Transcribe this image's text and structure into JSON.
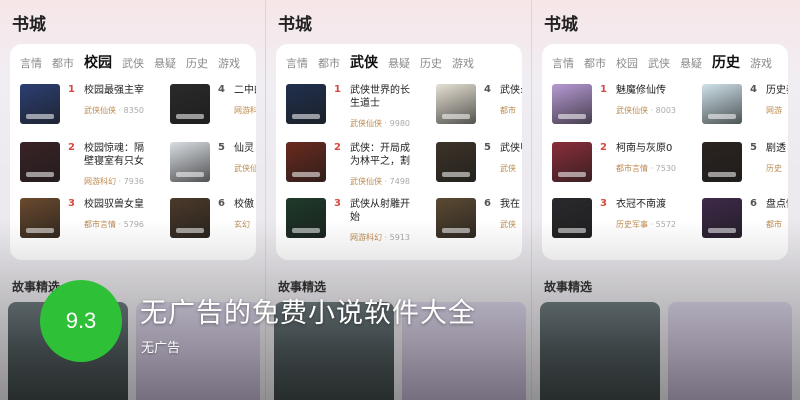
{
  "screens": [
    {
      "title": "书城",
      "tabs": [
        "言情",
        "都市",
        "校园",
        "武侠",
        "悬疑",
        "历史",
        "游戏"
      ],
      "active_tab": 2,
      "books": [
        {
          "rank": "1",
          "title": "校园最强主宰",
          "category": "武侠仙侠",
          "views": "8350"
        },
        {
          "rank": "2",
          "title": "校园惊魂：隔壁寝室有只女鬼",
          "category": "网游科幻",
          "views": "7936"
        },
        {
          "rank": "3",
          "title": "校园驭兽女皇",
          "category": "都市言情",
          "views": "5796"
        },
        {
          "rank": "4",
          "title": "二中的机",
          "category": "网游科",
          "views": ""
        },
        {
          "rank": "5",
          "title": "仙灵",
          "category": "武侠仙",
          "views": ""
        },
        {
          "rank": "6",
          "title": "校傲",
          "category": "玄幻",
          "views": ""
        }
      ],
      "section": "故事精选"
    },
    {
      "title": "书城",
      "tabs": [
        "言情",
        "都市",
        "武侠",
        "悬疑",
        "历史",
        "游戏"
      ],
      "active_tab": 2,
      "books": [
        {
          "rank": "1",
          "title": "武侠世界的长生道士",
          "category": "武侠仙侠",
          "views": "9980"
        },
        {
          "rank": "2",
          "title": "武侠：开局成为林平之，割以永治?",
          "category": "武侠仙侠",
          "views": "7498"
        },
        {
          "rank": "3",
          "title": "武侠从射雕开始",
          "category": "网游科幻",
          "views": "5913"
        },
        {
          "rank": "4",
          "title": "武侠:",
          "category": "都市",
          "views": ""
        },
        {
          "rank": "5",
          "title": "武侠甲子",
          "category": "武侠",
          "views": ""
        },
        {
          "rank": "6",
          "title": "我在",
          "category": "武侠",
          "views": ""
        }
      ],
      "section": "故事精选"
    },
    {
      "title": "书城",
      "tabs": [
        "言情",
        "都市",
        "校园",
        "武侠",
        "悬疑",
        "历史",
        "游戏"
      ],
      "active_tab": 5,
      "books": [
        {
          "rank": "1",
          "title": "魅魔修仙传",
          "category": "武侠仙侠",
          "views": "8003"
        },
        {
          "rank": "2",
          "title": "柯南与灰原0",
          "category": "都市言情",
          "views": "7530"
        },
        {
          "rank": "3",
          "title": "衣冠不南渡",
          "category": "历史军事",
          "views": "5572"
        },
        {
          "rank": "4",
          "title": "历史秦始",
          "category": "网游",
          "views": ""
        },
        {
          "rank": "5",
          "title": "剧透",
          "category": "历史",
          "views": ""
        },
        {
          "rank": "6",
          "title": "盘点性，",
          "category": "都市",
          "views": ""
        }
      ],
      "section": "故事精选"
    }
  ],
  "overlay": {
    "score": "9.3",
    "headline": "无广告的免费小说软件大全",
    "subline": "无广告"
  },
  "cover_colors": [
    "#2c3f73",
    "#3a2326",
    "#5a4630",
    "#2a2a2a",
    "#d9dde2",
    "#4b3a2a"
  ],
  "accent_color": "#2ec138"
}
